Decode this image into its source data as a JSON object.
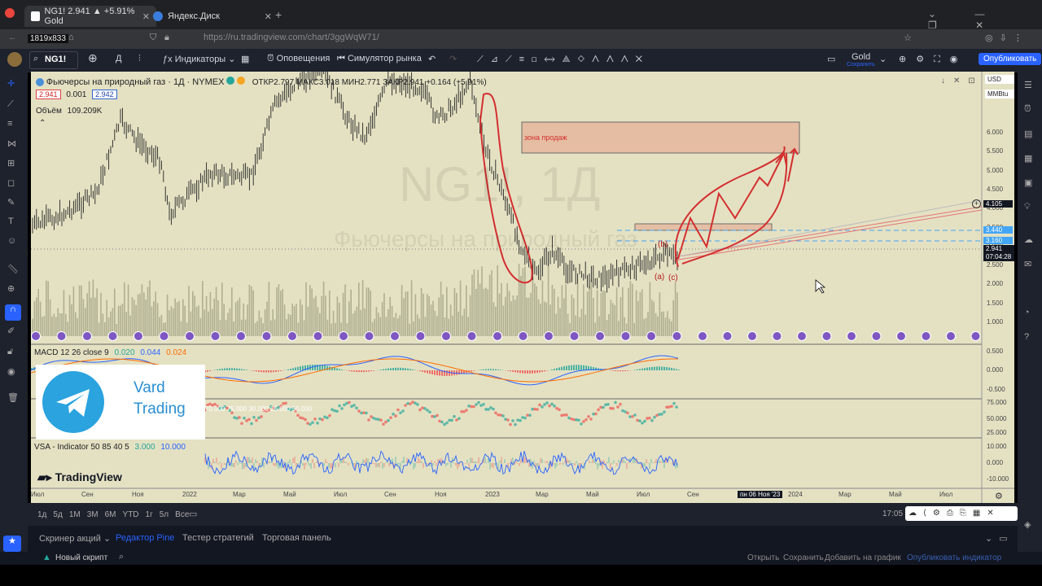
{
  "browser": {
    "tabs": [
      {
        "label": "NG1! 2.941 ▲ +5.91% Gold",
        "active": true
      },
      {
        "label": "Яндекс.Диск",
        "active": false
      }
    ],
    "size_badge": "1819x833",
    "url": "https://ru.tradingview.com/chart/3ggWqW71/"
  },
  "toolbar": {
    "symbol": "NG1!",
    "interval": "Д",
    "indicators": "Индикаторы",
    "alerts": "Оповещения",
    "replay": "Симулятор рынка",
    "layout_name": "Gold",
    "layout_status": "Сохранить",
    "publish": "Опубликовать"
  },
  "chart": {
    "title": "Фьючерсы на природный газ · 1Д · NYMEX",
    "ohlc": "ОТКР2.797 МАКС3.018 МИН2.771 ЗАКР2.941 +0.164 (+5.91%)",
    "bid": "2.941",
    "spread": "0.001",
    "ask": "2.942",
    "volume_label": "Объём",
    "volume_value": "109.209K",
    "watermark_symbol": "NG1!, 1Д",
    "watermark_desc": "Фьючерсы на природный газ",
    "currency": "USD",
    "unit": "MMBtu",
    "sell_zone": "зона продаж",
    "wave_b": "(b)",
    "wave_a": "(a)",
    "wave_c": "(c)",
    "price_labels": [
      "6.000",
      "5.500",
      "5.000",
      "4.500",
      "4.000",
      "3.500",
      "3.000",
      "2.500",
      "2.000",
      "1.500",
      "1.000"
    ],
    "tag_4105": "4.105",
    "tag_3440": "3.440",
    "tag_3160": "3.160",
    "tag_last": "2.941",
    "tag_timer": "07:04:28",
    "macd_label": "MACD 12 26 close 9",
    "macd_v1": "0.020",
    "macd_v2": "0.044",
    "macd_v3": "0.024",
    "macd_scale": [
      "0.500",
      "0.000",
      "-0.500"
    ],
    "rsi_scale": [
      "75.000",
      "50.000",
      "25.000"
    ],
    "rsi_values": "70.000  75.000  30.000  25.000  50.000",
    "vsa_label": "VSA - Indicator 50 85 40 5",
    "vsa_v1": "3.000",
    "vsa_v2": "10.000",
    "vsa_scale": [
      "10.000",
      "0.000",
      "-10.000"
    ],
    "time_labels": [
      "Июл",
      "Сен",
      "Ноя",
      "2022",
      "Мар",
      "Май",
      "Июл",
      "Сен",
      "Ноя",
      "2023",
      "Мар",
      "Май",
      "Июл",
      "Сен",
      "пн 06 Ноя '23",
      "2024",
      "Мар",
      "Май",
      "Июл"
    ],
    "brand": "TradingView"
  },
  "overlay": {
    "line1": "Vard",
    "line2": "Trading"
  },
  "ranges": [
    "1д",
    "5д",
    "1М",
    "3М",
    "6М",
    "YTD",
    "1г",
    "5л",
    "Все"
  ],
  "clock": "17:05",
  "panel_tabs": [
    "Скринер акций",
    "Редактор Pine",
    "Тестер стратегий",
    "Торговая панель"
  ],
  "pine": {
    "new_script": "Новый скрипт",
    "open": "Открыть",
    "save": "Сохранить",
    "add": "Добавить на график",
    "publish": "Опубликовать индикатор"
  },
  "colors": {
    "chart_bg": "#e4e1c3",
    "accent": "#2962ff",
    "bearish": "#e53935",
    "bullish": "#26a69a"
  }
}
